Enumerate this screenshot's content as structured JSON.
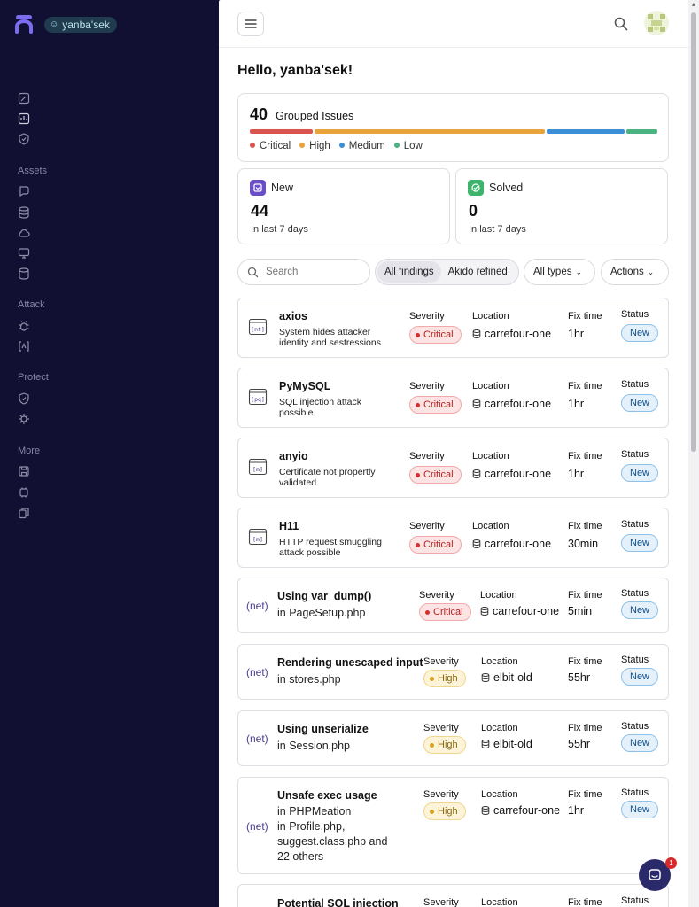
{
  "sidebar": {
    "workspace": "yanba'sek",
    "sections": [
      "Assets",
      "Attack",
      "Protect",
      "More"
    ]
  },
  "header": {
    "greeting": "Hello, yanba'sek!"
  },
  "issues": {
    "count": "40",
    "label": "Grouped Issues",
    "distribution": [
      0.16,
      0.59,
      0.2,
      0.08
    ],
    "legend": [
      "Critical",
      "High",
      "Medium",
      "Low"
    ],
    "colors": {
      "critical": "#d9534f",
      "high": "#e8a33a",
      "medium": "#3a8fd6",
      "low": "#4bb381"
    }
  },
  "stats": {
    "new": {
      "title": "New",
      "value": "44",
      "sub": "In last 7 days",
      "color": "#6a4fc9"
    },
    "solved": {
      "title": "Solved",
      "value": "0",
      "sub": "In last 7 days",
      "color": "#3db36b"
    }
  },
  "filters": {
    "search_placeholder": "Search",
    "seg_all": "All findings",
    "seg_refined": "Akido refined",
    "types": "All types",
    "actions": "Actions"
  },
  "columns": {
    "severity": "Severity",
    "location": "Location",
    "fix": "Fix time",
    "status": "Status"
  },
  "rows": [
    {
      "title": "axios",
      "desc": "System hides attacker identity and sestressions",
      "severity": "Critical",
      "location": "carrefour-one",
      "fix": "1hr",
      "status": "New",
      "icon_text": "[nt]"
    },
    {
      "title": "PyMySQL",
      "desc": "SQL injection attack possible",
      "severity": "Critical",
      "location": "carrefour-one",
      "fix": "1hr",
      "status": "New",
      "icon_text": "[pq]"
    },
    {
      "title": "anyio",
      "desc": "Certificate not propertly validated",
      "severity": "Critical",
      "location": "carrefour-one",
      "fix": "1hr",
      "status": "New",
      "icon_text": "[m]"
    },
    {
      "title": "H11",
      "desc": "HTTP request smuggling attack possible",
      "severity": "Critical",
      "location": "carrefour-one",
      "fix": "30min",
      "status": "New",
      "icon_text": "[m]"
    },
    {
      "title": "Using var_dump()",
      "desc": "in PageSetup.php",
      "severity": "Critical",
      "location": "carrefour-one",
      "fix": "5min",
      "status": "New",
      "icon_text": "(net)"
    },
    {
      "title": "Rendering unescaped input",
      "desc": "in stores.php",
      "severity": "High",
      "location": "elbit-old",
      "fix": "55hr",
      "status": "New",
      "icon_text": "(net)"
    },
    {
      "title": "Using unserialize",
      "desc": "in Session.php",
      "severity": "High",
      "location": "elbit-old",
      "fix": "55hr",
      "status": "New",
      "icon_text": "(net)"
    },
    {
      "title": "Unsafe exec usage",
      "desc_lines": [
        "in PHPMeation",
        "in Profile.php,",
        "suggest.class.php and",
        "22 others"
      ],
      "severity": "High",
      "location": "carrefour-one",
      "fix": "1hr",
      "status": "New",
      "icon_text": "(net)"
    },
    {
      "title": "Potential SQL injection"
    }
  ],
  "chat": {
    "badge": "1"
  }
}
